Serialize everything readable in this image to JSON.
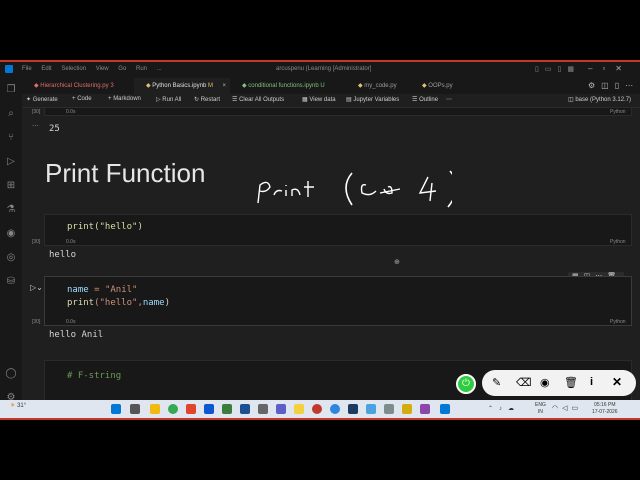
{
  "titlebar": {
    "menu": [
      "File",
      "Edit",
      "Selection",
      "View",
      "Go",
      "Run",
      "..."
    ],
    "title": "arcuspenu (Learning [Administrator]"
  },
  "tabs": [
    {
      "label": "Hierarchical Clustering.py",
      "badge": "3",
      "color": "#e06c6c",
      "active": false
    },
    {
      "label": "Python Basics.ipynb",
      "badge": "M",
      "color": "#e0c070",
      "active": true
    },
    {
      "label": "conditional functions.ipynb",
      "badge": "U",
      "color": "#7fc27f",
      "active": false
    },
    {
      "label": "my_code.py",
      "badge": "",
      "color": "#9d9d9d",
      "active": false
    },
    {
      "label": "OOPs.py",
      "badge": "",
      "color": "#9d9d9d",
      "active": false
    }
  ],
  "toolbar": {
    "generate": "Generate",
    "code": "Code",
    "markdown": "Markdown",
    "run_all": "Run All",
    "restart": "Restart",
    "clear": "Clear All Outputs",
    "variables": "View data",
    "jupyter": "Jupyter Variables",
    "outline": "Outline",
    "kernel": "base (Python 3.12.7)"
  },
  "cells": {
    "top": {
      "exec": "[30]",
      "time": "0.0s",
      "lang": "Python",
      "output": "25"
    },
    "heading": "Print Function",
    "handwriting": "Print ( ←→ )",
    "cell1": {
      "code": "print(\"hello\")",
      "exec": "[30]",
      "time": "0.0s",
      "lang": "Python",
      "output": "hello"
    },
    "cell2": {
      "line1_var": "name",
      "line1_rest": " = \"Anil\"",
      "line2_fn": "print",
      "line2_rest": "(\"hello\",",
      "line2_var": "name",
      "line2_end": ")",
      "exec": "[30]",
      "time": "0.0s",
      "lang": "Python",
      "output": "hello Anil"
    },
    "cell3": {
      "comment": "# F-string"
    }
  },
  "taskbar": {
    "weather": "31°",
    "lang1": "ENG",
    "lang2": "IN",
    "time": "05:16 PM",
    "date": "17-07-2026"
  },
  "colors": {
    "accent": "#0e639c",
    "keyword": "#dcdcaa",
    "var": "#9cdcfe",
    "string": "#ce9178",
    "comment": "#6a9955",
    "green": "#2ecc40"
  }
}
